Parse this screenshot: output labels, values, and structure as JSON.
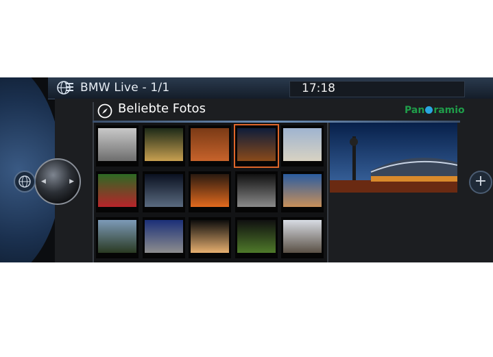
{
  "titlebar": {
    "app_title": "BMW Live - 1/1",
    "clock": "17:18",
    "icon": "globe-menu-icon"
  },
  "header": {
    "title": "Beliebte Fotos",
    "icon": "compass-icon",
    "brand": {
      "pre": "Pan",
      "post": "ramio"
    }
  },
  "controller": {
    "icon": "navigation-controller-icon"
  },
  "side_buttons": {
    "left_icon": "globe-icon",
    "right_label": "+"
  },
  "photo_grid": {
    "rows": 3,
    "cols": 5,
    "selected_index": 3
  },
  "colors": {
    "selection": "#e0662a",
    "brand_green": "#1f9e4a",
    "brand_blue": "#2aa6e0"
  }
}
